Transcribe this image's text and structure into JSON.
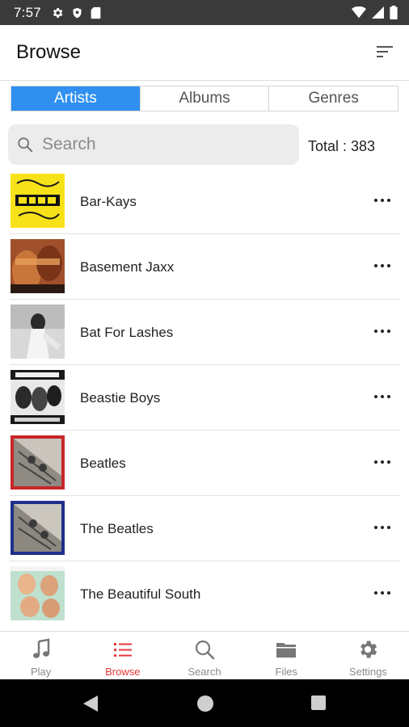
{
  "status_bar": {
    "time": "7:57",
    "left_icons": [
      "gear-icon",
      "shield-icon",
      "sd-card-icon"
    ],
    "right_icons": [
      "wifi-icon",
      "signal-icon",
      "battery-icon"
    ]
  },
  "header": {
    "title": "Browse",
    "sort_icon": "sort-icon"
  },
  "tabs": [
    {
      "label": "Artists",
      "active": true
    },
    {
      "label": "Albums",
      "active": false
    },
    {
      "label": "Genres",
      "active": false
    }
  ],
  "search": {
    "placeholder": "Search",
    "value": "",
    "total_label": "Total : 383"
  },
  "artists": [
    {
      "name": "Bar-Kays",
      "art": "atlantic-soul-classics"
    },
    {
      "name": "Basement Jaxx",
      "art": "basement-jaxx"
    },
    {
      "name": "Bat For Lashes",
      "art": "bat-for-lashes"
    },
    {
      "name": "Beastie Boys",
      "art": "beastie-boys"
    },
    {
      "name": "Beatles",
      "art": "beatles-red"
    },
    {
      "name": "The Beatles",
      "art": "beatles-blue"
    },
    {
      "name": "The Beautiful South",
      "art": "beautiful-south"
    }
  ],
  "bottom_nav": [
    {
      "label": "Play",
      "icon": "music-note-icon",
      "active": false
    },
    {
      "label": "Browse",
      "icon": "list-icon",
      "active": true
    },
    {
      "label": "Search",
      "icon": "search-icon",
      "active": false
    },
    {
      "label": "Files",
      "icon": "folder-icon",
      "active": false
    },
    {
      "label": "Settings",
      "icon": "gear-icon",
      "active": false
    }
  ],
  "colors": {
    "accent_blue": "#2f90f0",
    "active_red": "#e5383b",
    "status_bar": "#3a3a3a"
  }
}
